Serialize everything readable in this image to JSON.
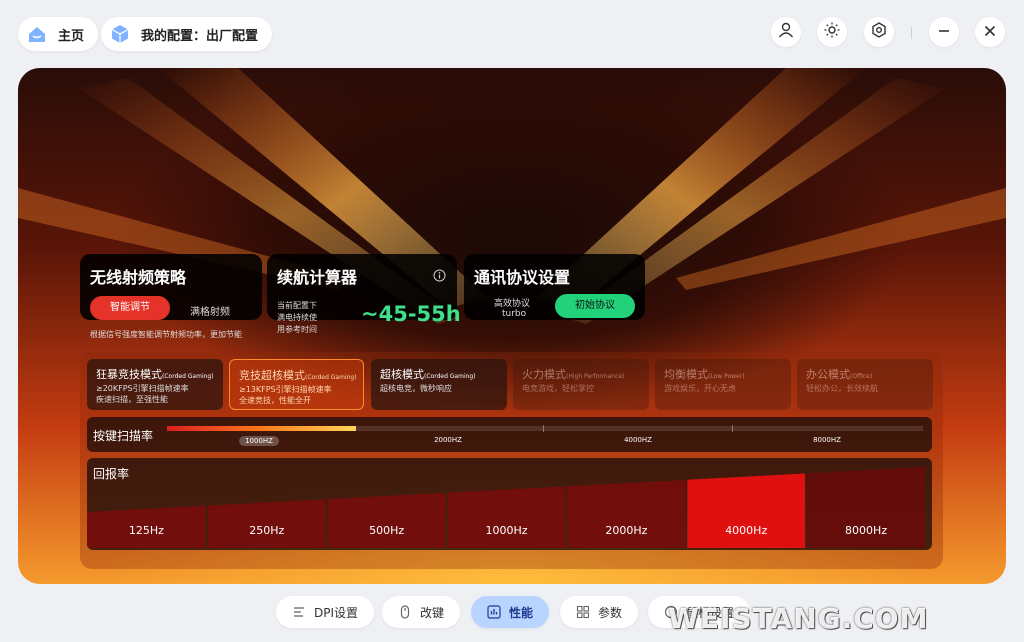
{
  "header": {
    "home_label": "主页",
    "config_label": "我的配置：出厂配置"
  },
  "wireless": {
    "title": "无线射频策略",
    "smart_label": "智能调节",
    "full_label": "满格射频",
    "desc": "根据信号强度智能调节射频功率，更加节能"
  },
  "battery": {
    "title": "续航计算器",
    "desc_line1": "当前配置下",
    "desc_line2": "满电持续使",
    "desc_line3": "用参考时间",
    "value": "~45-55h"
  },
  "protocol": {
    "title": "通讯协议设置",
    "efficient_label": "高效协议",
    "efficient_value": "turbo",
    "init_label": "初始协议"
  },
  "modes": [
    {
      "name": "狂暴竞技模式",
      "tag": "(Corded Gaming)",
      "line1": "≥20KFPS引擎扫描帧速率",
      "line2": "疾速扫描，至强性能"
    },
    {
      "name": "竞技超核模式",
      "tag": "(Corded Gaming)",
      "line1": "≥13KFPS引擎扫描帧速率",
      "line2": "全速竞技，性能全开"
    },
    {
      "name": "超核模式",
      "tag": "(Corded Gaming)",
      "line1": "超核电竞，微秒响应",
      "line2": ""
    },
    {
      "name": "火力模式",
      "tag": "(High Performance)",
      "line1": "电竞游戏，轻松掌控",
      "line2": ""
    },
    {
      "name": "均衡模式",
      "tag": "(Low Power)",
      "line1": "游戏娱乐，开心无虑",
      "line2": ""
    },
    {
      "name": "办公模式",
      "tag": "(Office)",
      "line1": "轻松办公，长效续航",
      "line2": ""
    }
  ],
  "scan": {
    "label": "按键扫描率",
    "ticks": [
      "1000HZ",
      "2000HZ",
      "4000HZ",
      "8000HZ"
    ],
    "fill_fraction": 0.25
  },
  "report": {
    "label": "回报率",
    "rates": [
      "125Hz",
      "250Hz",
      "500Hz",
      "1000Hz",
      "2000Hz",
      "4000Hz",
      "8000Hz"
    ],
    "selected": "4000Hz"
  },
  "tabs": {
    "dpi": "DPI设置",
    "keys": "改键",
    "perf": "性能",
    "params": "参数",
    "mouse": "鼠标设置"
  },
  "watermark": "WEISTANG.COM",
  "colors": {
    "accent_red": "#e6332a",
    "accent_green": "#22d27a",
    "active_tab": "#b9d4ff"
  }
}
